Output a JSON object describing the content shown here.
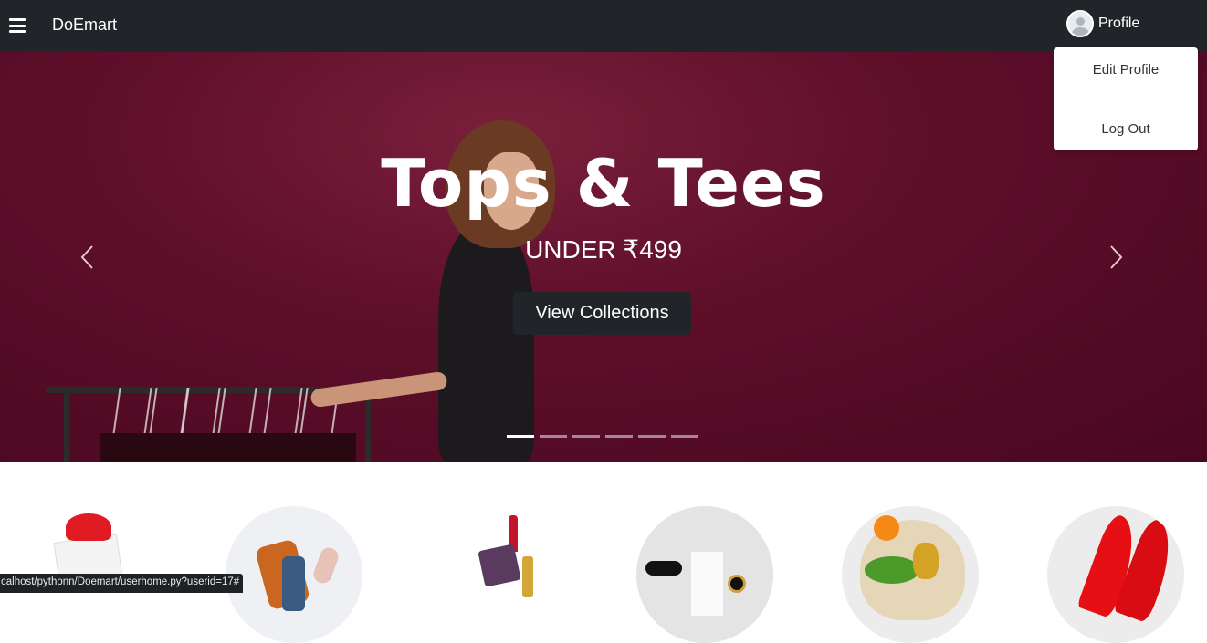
{
  "navbar": {
    "menu_icon": "hamburger-icon",
    "brand": "DoEmart",
    "profile_label": "Profile",
    "avatar_icon": "user-avatar-icon"
  },
  "profile_menu": {
    "items": [
      "Edit Profile",
      "Log Out"
    ]
  },
  "hero": {
    "title": "Tops & Tees",
    "subtitle": "UNDER ₹499",
    "button_label": "View Collections",
    "prev_icon": "chevron-left-icon",
    "next_icon": "chevron-right-icon",
    "slide_count": 6,
    "active_slide": 1,
    "background_color": "#5e0f2a"
  },
  "categories": {
    "icons": [
      "gift-image",
      "fashion-image",
      "cosmetics-image",
      "accessories-image",
      "grocery-image",
      "footwear-image"
    ]
  },
  "statusbar": {
    "url": "calhost/pythonn/Doemart/userhome.py?userid=17#"
  }
}
